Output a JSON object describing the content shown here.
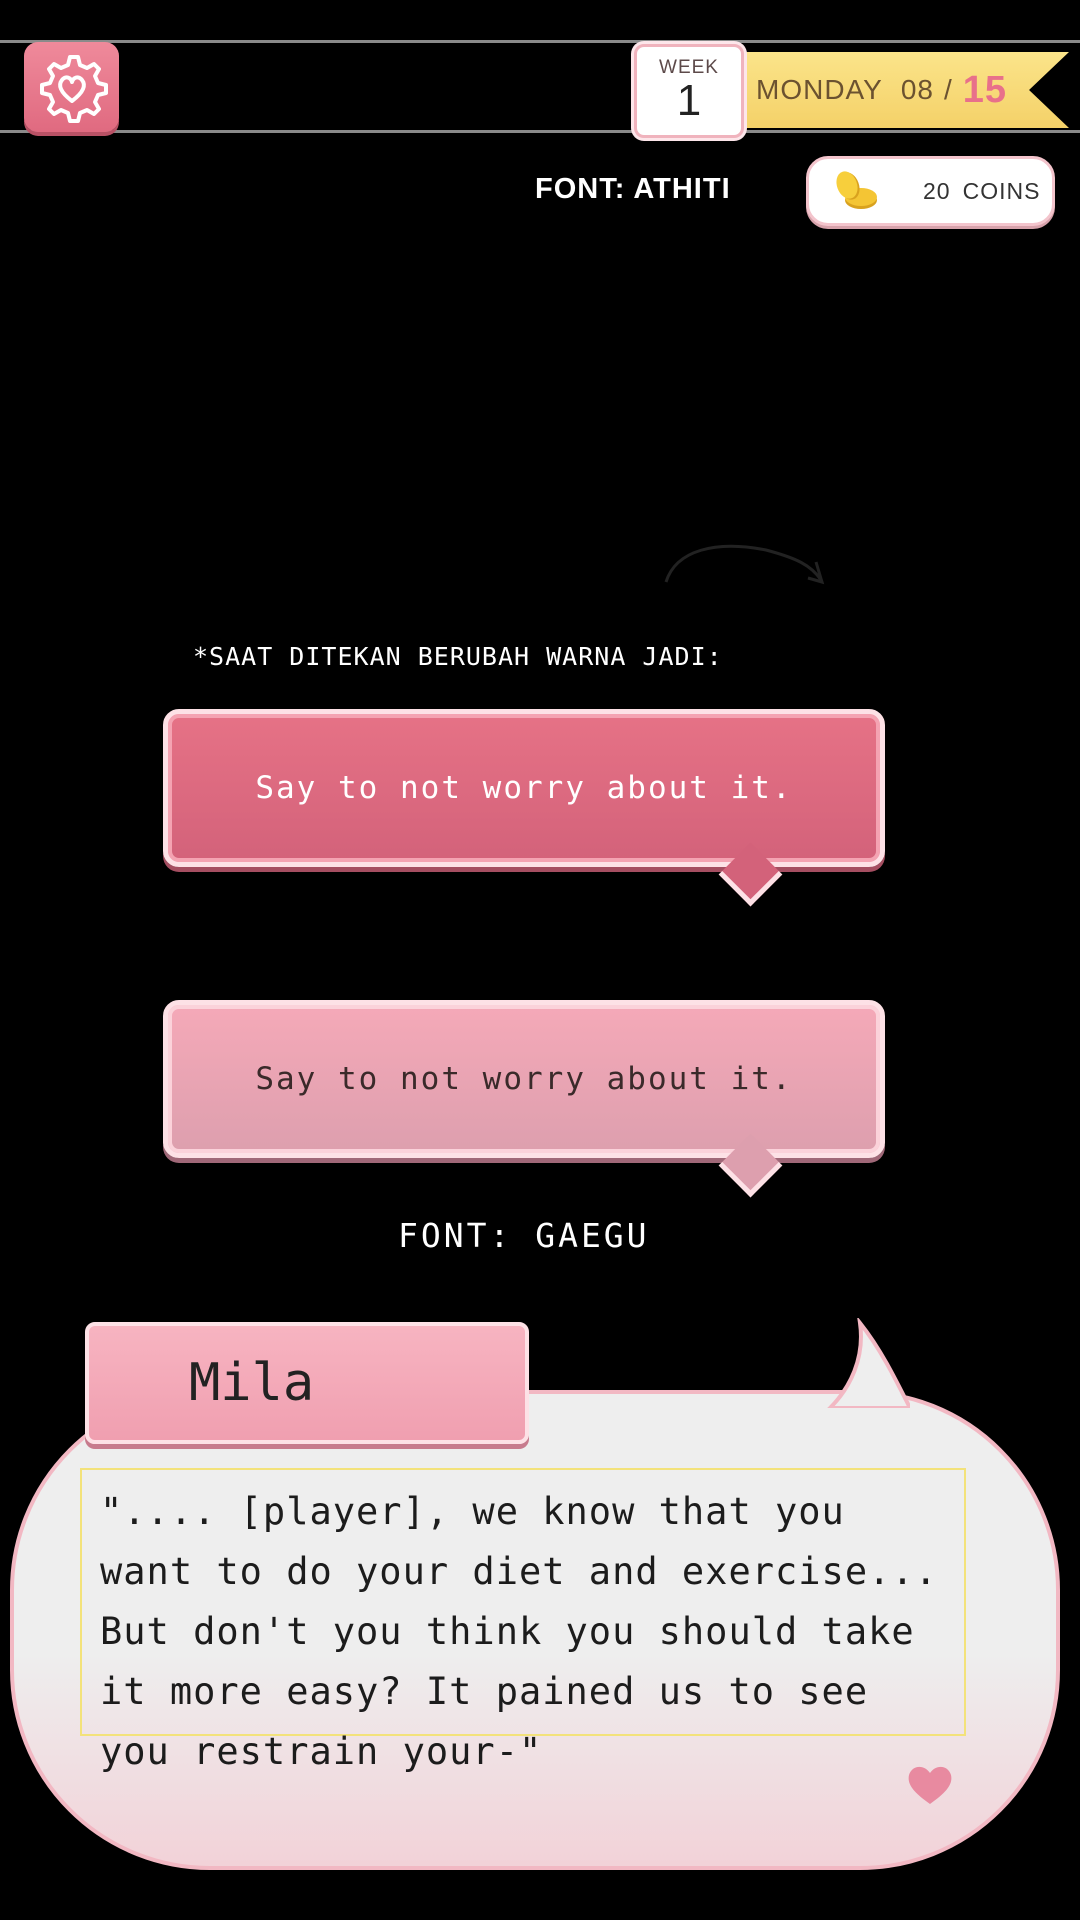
{
  "hud": {
    "week_label": "WEEK",
    "week_number": "1",
    "day": "MONDAY",
    "date_current": "08",
    "date_separator": "/",
    "date_total": "15",
    "coins_value": "20",
    "coins_unit": "COINS",
    "font_note_top": "FONT: ATHITI"
  },
  "note": "*SAAT DITEKAN BERUBAH WARNA JADI:",
  "choices": [
    {
      "label": "Say to not worry about it.",
      "state": "pressed"
    },
    {
      "label": "Say to not worry about it.",
      "state": "normal"
    }
  ],
  "font_note_bottom": "FONT: GAEGU",
  "dialogue": {
    "speaker": "Mila",
    "text": "\".... [player], we know that you want to do your diet and exercise... But don't you think you should take it more easy? It pained us to see you restrain your-\""
  },
  "icons": {
    "settings": "gear-heart-icon",
    "coins": "coin-stack-icon",
    "continue": "heart-icon"
  },
  "colors": {
    "accent_pink": "#e67286",
    "ribbon_yellow": "#f4d168",
    "bubble_border": "#f2b8c3"
  }
}
